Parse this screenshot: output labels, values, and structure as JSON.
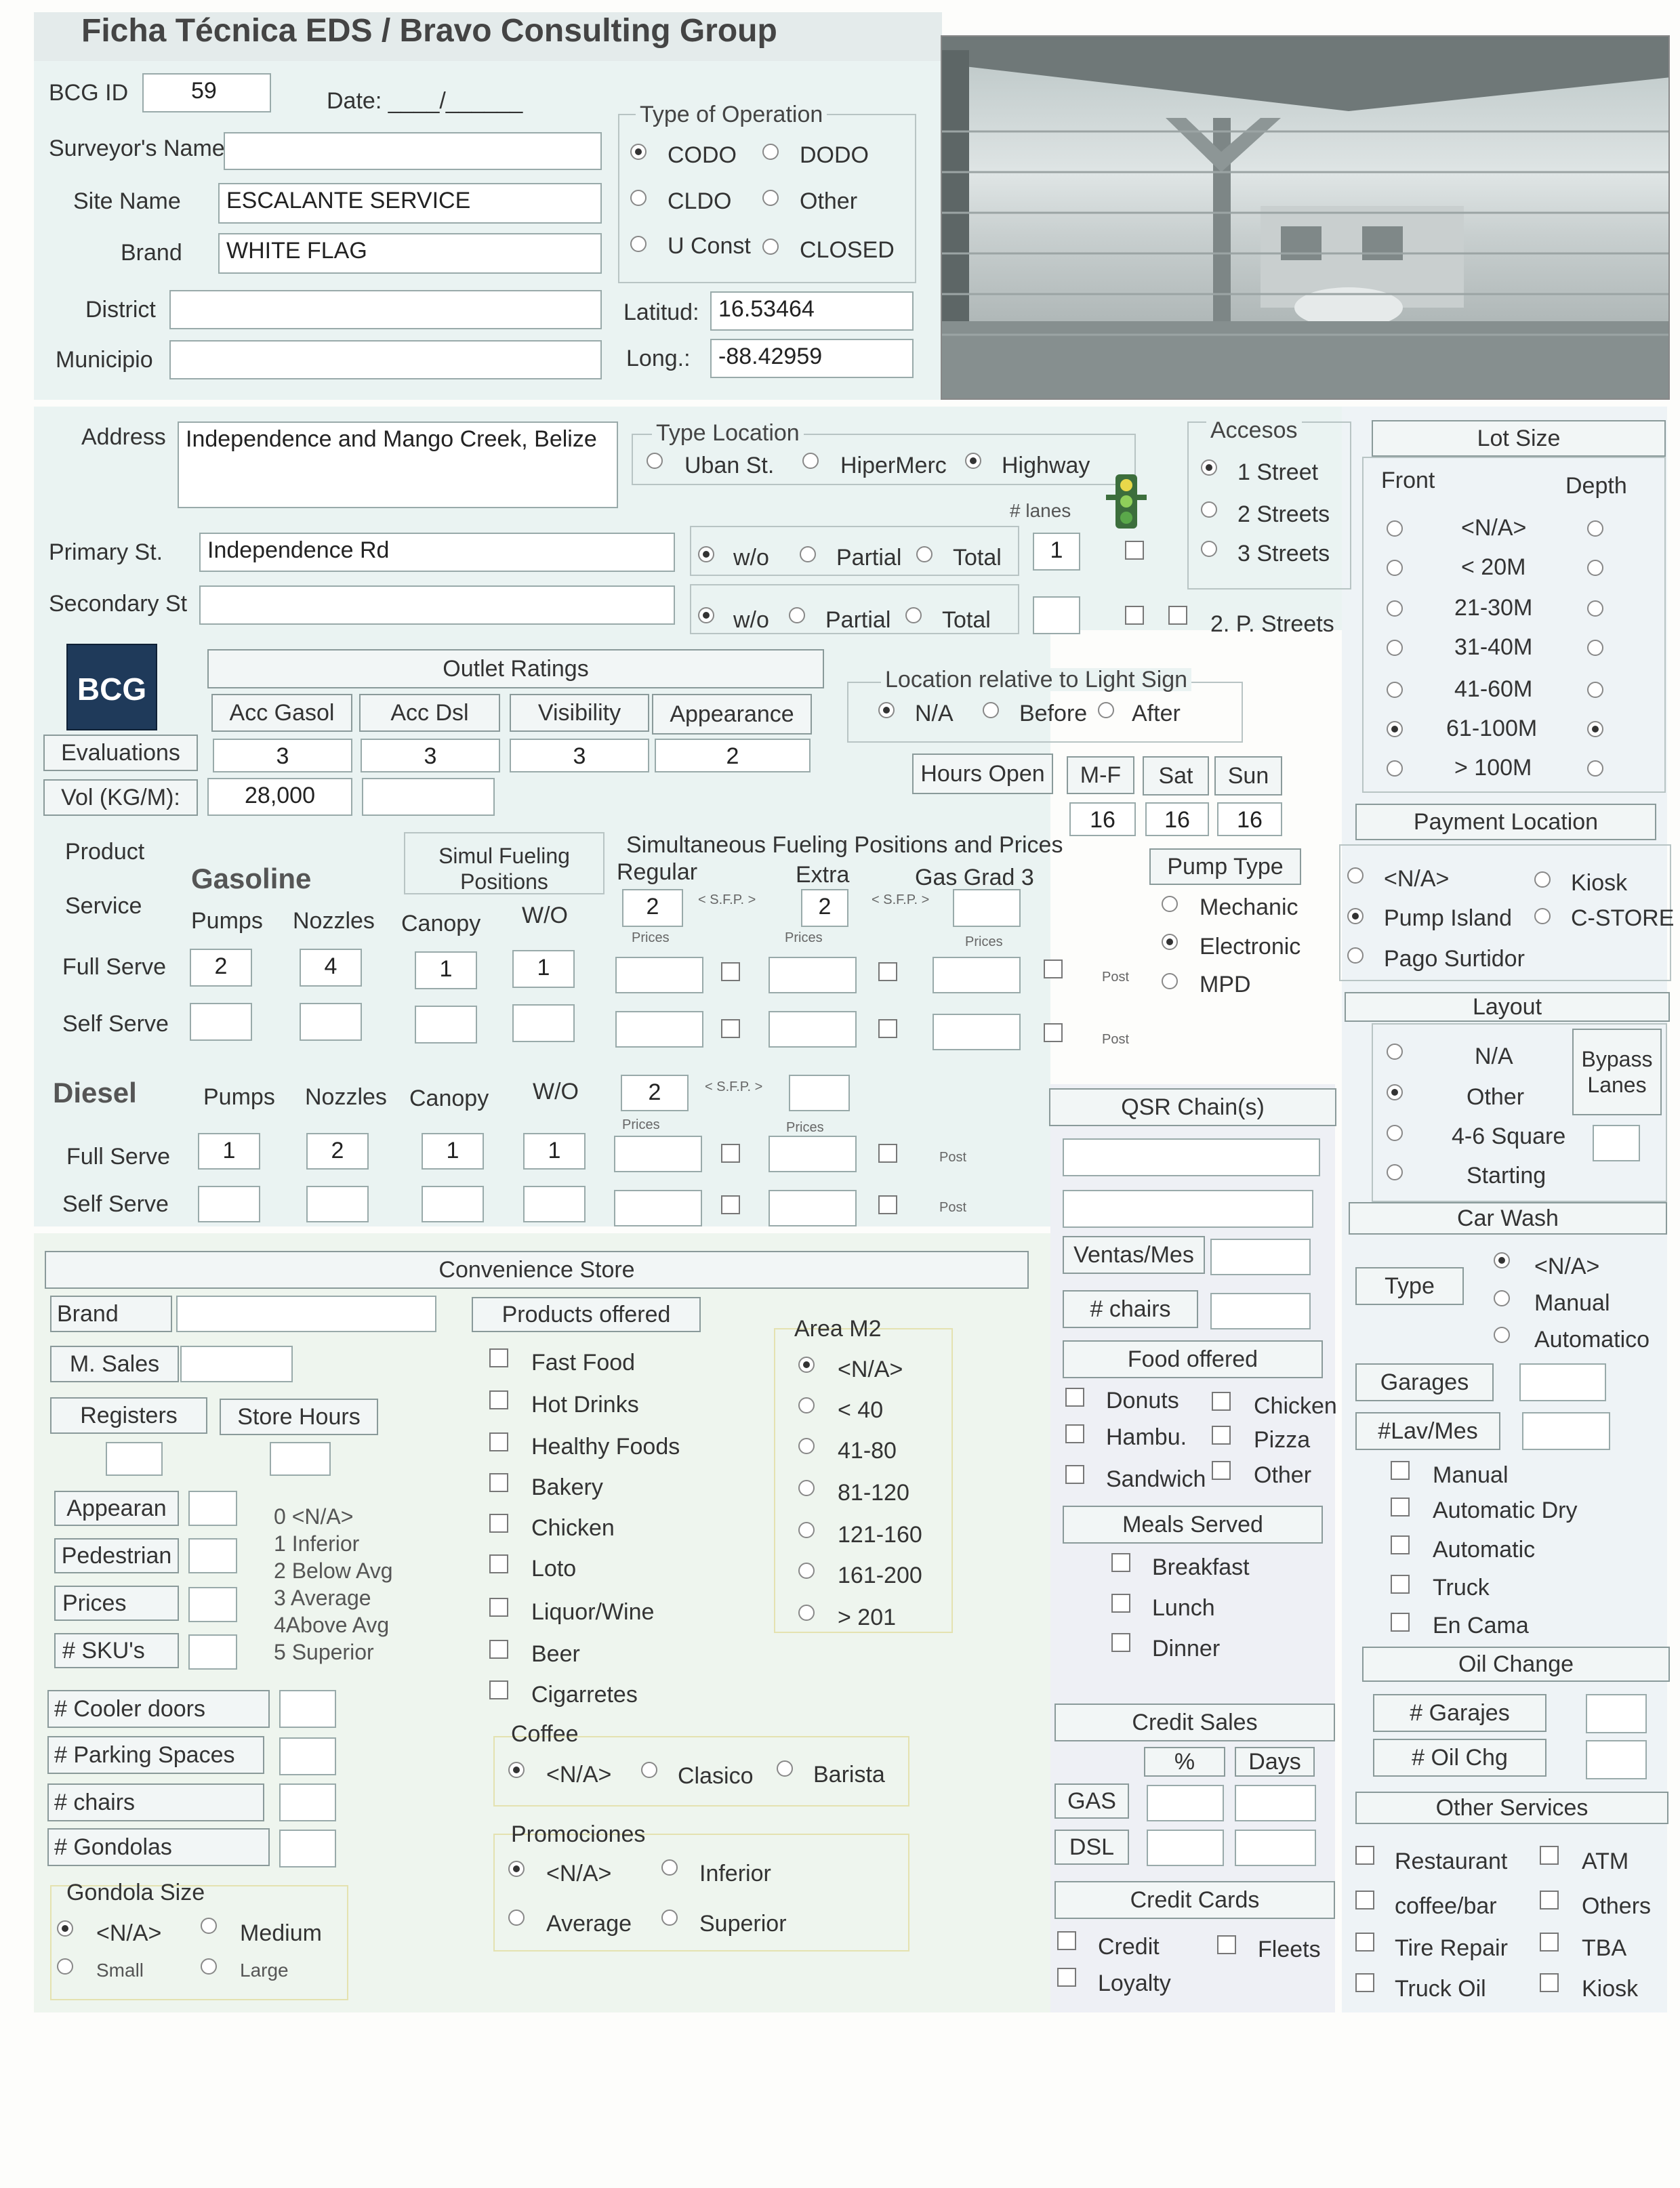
{
  "title": "Ficha Técnica EDS / Bravo Consulting Group",
  "header": {
    "bcg_id_label": "BCG ID",
    "bcg_id": "59",
    "date_label": "Date: ____/______",
    "surveyor_label": "Surveyor's Name",
    "surveyor": "",
    "site_label": "Site Name",
    "site": "ESCALANTE SERVICE",
    "brand_label": "Brand",
    "brand": "WHITE FLAG",
    "district_label": "District",
    "district": "",
    "municipio_label": "Municipio",
    "municipio": "",
    "latitude_label": "Latitud:",
    "latitude": "16.53464",
    "longitude_label": "Long.:",
    "longitude": "-88.42959"
  },
  "operation": {
    "title": "Type of Operation",
    "options": [
      "CODO",
      "DODO",
      "CLDO",
      "Other",
      "U Const",
      "CLOSED"
    ],
    "selected": "CODO"
  },
  "address": {
    "label": "Address",
    "value": "Independence and Mango Creek, Belize",
    "primary_label": "Primary St.",
    "primary": "Independence Rd",
    "secondary_label": "Secondary St",
    "secondary": ""
  },
  "location_type": {
    "title": "Type Location",
    "options": [
      "Uban St.",
      "HiperMerc",
      "Highway"
    ],
    "selected": "Highway",
    "lanes_label": "# lanes",
    "lanes": "1"
  },
  "medians": {
    "options": [
      "w/o",
      "Partial",
      "Total"
    ],
    "primary_selected": "w/o",
    "secondary_selected": "w/o"
  },
  "access": {
    "title": "Accesos",
    "options": [
      "1 Street",
      "2 Streets",
      "3 Streets"
    ],
    "selected": "1 Street",
    "two_p_label": "2. P. Streets"
  },
  "lot_size": {
    "title": "Lot Size",
    "front_label": "Front",
    "depth_label": "Depth",
    "options": [
      "<N/A>",
      "< 20M",
      "21-30M",
      "31-40M",
      "41-60M",
      "61-100M",
      "> 100M"
    ],
    "front_selected": "61-100M",
    "depth_selected": "61-100M"
  },
  "ratings": {
    "logo": "BCG",
    "evaluations_label": "Evaluations",
    "vol_label": "Vol (KG/M):",
    "vol": "28,000",
    "title": "Outlet Ratings",
    "cols": [
      {
        "label": "Acc Gasol",
        "value": "3"
      },
      {
        "label": "Acc Dsl",
        "value": "3"
      },
      {
        "label": "Visibility",
        "value": "3"
      },
      {
        "label": "Appearance",
        "value": "2"
      }
    ]
  },
  "light_sign": {
    "title": "Location relative to Light Sign",
    "options": [
      "N/A",
      "Before",
      "After"
    ],
    "selected": "N/A"
  },
  "hours": {
    "label": "Hours Open",
    "days": [
      {
        "label": "M-F",
        "value": "16"
      },
      {
        "label": "Sat",
        "value": "16"
      },
      {
        "label": "Sun",
        "value": "16"
      }
    ]
  },
  "payment": {
    "title": "Payment Location",
    "options": [
      "<N/A>",
      "Kiosk",
      "Pump Island",
      "C-STORE",
      "Pago Surtidor"
    ],
    "selected": "Pump Island"
  },
  "fuel": {
    "product_label": "Product",
    "service_label": "Service",
    "gasoline_label": "Gasoline",
    "diesel_label": "Diesel",
    "simul_label": "Simul Fueling Positions",
    "simul_prices_label": "Simultaneous Fueling Positions and Prices",
    "cols": [
      "Pumps",
      "Nozzles",
      "Canopy",
      "W/O"
    ],
    "grades": [
      "Regular",
      "Extra",
      "Gas Grad 3"
    ],
    "sfp_label": "< S.F.P. >",
    "prices_label": "Prices",
    "post_label": "Post",
    "full_label": "Full Serve",
    "self_label": "Self Serve",
    "gas_full": {
      "pumps": "2",
      "nozzles": "4",
      "canopy": "1",
      "wo": "1"
    },
    "gas_sfp": {
      "regular": "2",
      "extra": "2"
    },
    "dsl_full": {
      "pumps": "1",
      "nozzles": "2",
      "canopy": "1",
      "wo": "1"
    },
    "dsl_sfp": "2"
  },
  "pump_type": {
    "title": "Pump Type",
    "options": [
      "Mechanic",
      "Electronic",
      "MPD"
    ],
    "selected": "Electronic"
  },
  "layout": {
    "title": "Layout",
    "options": [
      "N/A",
      "Other",
      "4-6 Square",
      "Starting"
    ],
    "selected": "Other",
    "bypass_label": "Bypass Lanes"
  },
  "car_wash": {
    "title": "Car Wash",
    "type_label": "Type",
    "type_options": [
      "<N/A>",
      "Manual",
      "Automatico"
    ],
    "type_selected": "<N/A>",
    "garages_label": "Garages",
    "lav_label": "#Lav/Mes",
    "checks": [
      "Manual",
      "Automatic Dry",
      "Automatic",
      "Truck",
      "En Cama"
    ]
  },
  "oil_change": {
    "title": "Oil Change",
    "garajes_label": "# Garajes",
    "oil_label": "# Oil Chg"
  },
  "other_services": {
    "title": "Other Services",
    "items": [
      "Restaurant",
      "ATM",
      "coffee/bar",
      "Others",
      "Tire Repair",
      "TBA",
      "Truck Oil",
      "Kiosk"
    ]
  },
  "qsr": {
    "title": "QSR Chain(s)",
    "ventas_label": "Ventas/Mes",
    "chairs_label": "# chairs",
    "food_title": "Food offered",
    "food": [
      "Donuts",
      "Chicken",
      "Hambu.",
      "Pizza",
      "Sandwich",
      "Other"
    ],
    "meals_title": "Meals Served",
    "meals": [
      "Breakfast",
      "Lunch",
      "Dinner"
    ]
  },
  "credit": {
    "sales_title": "Credit Sales",
    "pct_label": "%",
    "days_label": "Days",
    "gas_label": "GAS",
    "dsl_label": "DSL",
    "cards_title": "Credit Cards",
    "cards": [
      "Credit",
      "Fleets",
      "Loyalty"
    ]
  },
  "store": {
    "title": "Convenience Store",
    "brand_label": "Brand",
    "sales_label": "M. Sales",
    "registers_label": "Registers",
    "hours_label": "Store Hours",
    "ratings": [
      "Appearan",
      "Pedestrian",
      "Prices",
      "# SKU's"
    ],
    "scale": [
      "0 <N/A>",
      "1 Inferior",
      "2 Below Avg",
      "3 Average",
      "4Above Avg",
      "5 Superior"
    ],
    "counts": [
      "# Cooler doors",
      "# Parking Spaces",
      "# chairs",
      "# Gondolas"
    ],
    "gondola_title": "Gondola Size",
    "gondola_options": [
      "<N/A>",
      "Medium",
      "Small",
      "Large"
    ],
    "gondola_selected": "<N/A>",
    "products_title": "Products offered",
    "products": [
      "Fast Food",
      "Hot Drinks",
      "Healthy Foods",
      "Bakery",
      "Chicken",
      "Loto",
      "Liquor/Wine",
      "Beer",
      "Cigarretes"
    ],
    "area_title": "Area M2",
    "area_options": [
      "<N/A>",
      "< 40",
      "41-80",
      "81-120",
      "121-160",
      "161-200",
      "> 201"
    ],
    "area_selected": "<N/A>",
    "coffee_title": "Coffee",
    "coffee_options": [
      "<N/A>",
      "Clasico",
      "Barista"
    ],
    "coffee_selected": "<N/A>",
    "promo_title": "Promociones",
    "promo_options": [
      "<N/A>",
      "Inferior",
      "Average",
      "Superior"
    ],
    "promo_selected": "<N/A>"
  }
}
